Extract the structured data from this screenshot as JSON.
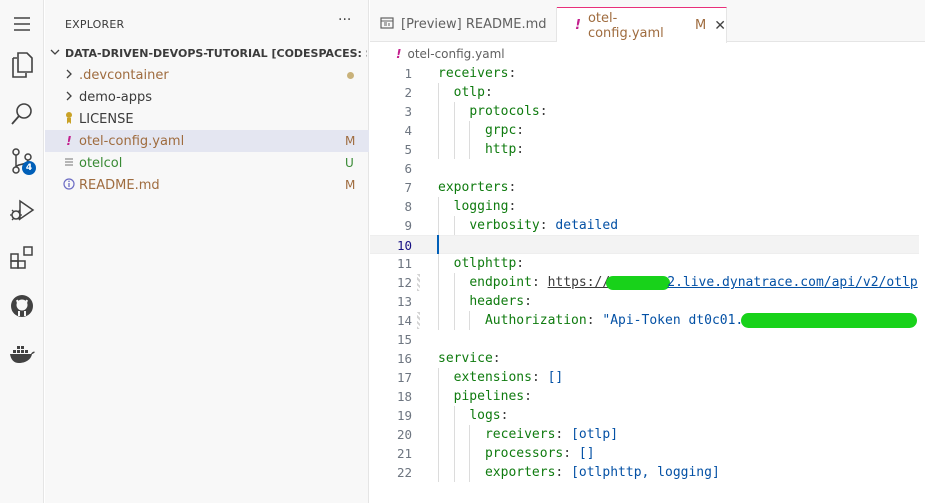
{
  "activity_bar": {
    "icons": [
      "menu-icon",
      "files-icon",
      "search-icon",
      "source-control-icon",
      "run-debug-icon",
      "extensions-icon",
      "github-icon",
      "docker-icon"
    ],
    "scm_badge": "4"
  },
  "sidebar": {
    "title": "EXPLORER",
    "more": "···",
    "root_label": "DATA-DRIVEN-DEVOPS-TUTORIAL [CODESPACES: STUDI...",
    "items": [
      {
        "label": ".devcontainer",
        "status": "",
        "type": "folder",
        "color": "#9f6c3f"
      },
      {
        "label": "demo-apps",
        "status": "",
        "type": "folder",
        "color": "#3b3b3b"
      },
      {
        "label": "LICENSE",
        "status": "",
        "type": "license",
        "color": "#3b3b3b"
      },
      {
        "label": "otel-config.yaml",
        "status": "M",
        "type": "yaml",
        "color": "#9f6c3f"
      },
      {
        "label": "otelcol",
        "status": "U",
        "type": "file",
        "color": "#388a34"
      },
      {
        "label": "README.md",
        "status": "M",
        "type": "info",
        "color": "#9f6c3f"
      }
    ]
  },
  "tabs": [
    {
      "label": "[Preview] README.md",
      "active": false
    },
    {
      "label": "otel-config.yaml",
      "status": "M",
      "active": true,
      "close": "✕"
    }
  ],
  "breadcrumb": {
    "file": "otel-config.yaml"
  },
  "editor": {
    "current_line": 10,
    "lines": [
      "receivers:",
      "  otlp:",
      "    protocols:",
      "      grpc:",
      "      http:",
      "",
      "exporters:",
      "  logging:",
      "    verbosity: detailed",
      "",
      "  otlphttp:",
      "    endpoint: https://",
      "    headers:",
      "      Authorization: \"Api-Token dt0c01.",
      "",
      "service:",
      "  extensions: []",
      "  pipelines:",
      "    logs:",
      "      receivers: [otlp]",
      "      processors: []",
      "      exporters: [otlphttp, logging]"
    ],
    "endpoint_suffix": "2.live.dynatrace.com/api/v2/otlp"
  }
}
